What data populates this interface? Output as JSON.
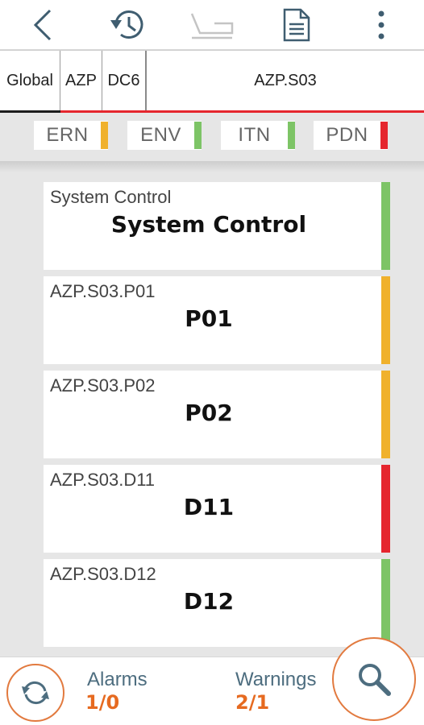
{
  "toolbar": {
    "back_icon": "chevron-left-icon",
    "history_icon": "history-icon",
    "graph_icon": "graph-icon",
    "document_icon": "document-icon",
    "menu_icon": "more-vertical-icon"
  },
  "breadcrumb": {
    "items": [
      "Global",
      "AZP",
      "DC6"
    ],
    "current": "AZP.S03"
  },
  "status_chips": [
    {
      "label": "ERN",
      "color": "#f0b12c"
    },
    {
      "label": "ENV",
      "color": "#7dc466"
    },
    {
      "label": "ITN",
      "color": "#7dc466"
    },
    {
      "label": "PDN",
      "color": "#e5262e"
    }
  ],
  "cards": [
    {
      "code": "System Control",
      "title": "System Control",
      "color": "#7dc466"
    },
    {
      "code": "AZP.S03.P01",
      "title": "P01",
      "color": "#f0b12c"
    },
    {
      "code": "AZP.S03.P02",
      "title": "P02",
      "color": "#f0b12c"
    },
    {
      "code": "AZP.S03.D11",
      "title": "D11",
      "color": "#e5262e"
    },
    {
      "code": "AZP.S03.D12",
      "title": "D12",
      "color": "#7dc466"
    }
  ],
  "footer": {
    "alarms_label": "Alarms",
    "alarms_value": "1/0",
    "warnings_label": "Warnings",
    "warnings_value": "2/1"
  },
  "colors": {
    "accent": "#e66a20",
    "breadcrumb_underline": "#e5262e"
  }
}
